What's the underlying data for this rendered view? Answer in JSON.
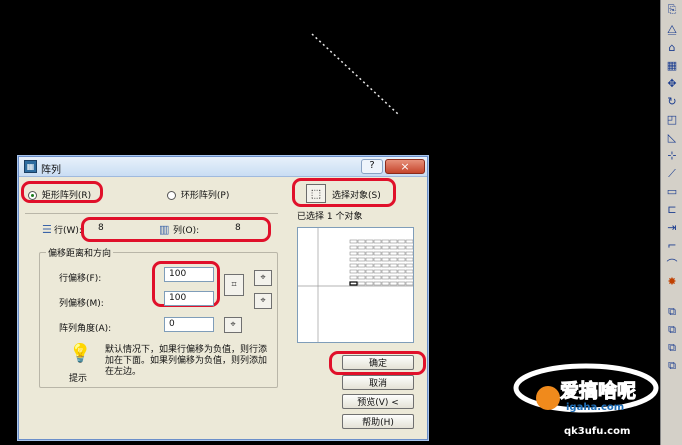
{
  "dialog": {
    "title": "阵列",
    "title_controls": {
      "help": "?",
      "close": "×"
    },
    "mode": {
      "rect_label": "矩形阵列(R)",
      "polar_label": "环形阵列(P)",
      "selected": "rect"
    },
    "select_objects_label": "选择对象(S)",
    "selected_count_text": "已选择 1 个对象",
    "rows_label": "行(W):",
    "rows_value": "8",
    "cols_label": "列(O):",
    "cols_value": "8",
    "offset_group_title": "偏移距离和方向",
    "row_offset_label": "行偏移(F):",
    "row_offset_value": "100",
    "col_offset_label": "列偏移(M):",
    "col_offset_value": "100",
    "angle_label": "阵列角度(A):",
    "angle_value": "0",
    "tip_title": "提示",
    "tip_text": "默认情况下，如果行偏移为负值，则行添加在下面。如果列偏移为负值，则列添加在左边。",
    "buttons": {
      "ok": "确定",
      "cancel": "取消",
      "preview": "预览(V) <",
      "help": "帮助(H)"
    }
  },
  "watermark": {
    "line1": "爱搞啥呢",
    "line2": "igaha.com",
    "line3": "qk3ufu.com"
  },
  "colors": {
    "canvas_bg": "#000000",
    "highlight_oval": "#e0102a",
    "dialog_bg": "#ece9d8",
    "toolbar_bg": "#d4d0c8"
  },
  "toolbar_icons": [
    "copy-icon",
    "mirror-icon",
    "offset-icon",
    "array-icon",
    "move-icon",
    "rotate-icon",
    "scale-icon",
    "stretch-icon",
    "trim-icon",
    "extend-icon",
    "break-at-point-icon",
    "break-icon",
    "join-icon",
    "chamfer-icon",
    "fillet-icon",
    "explode-icon",
    "draworder-icon"
  ]
}
